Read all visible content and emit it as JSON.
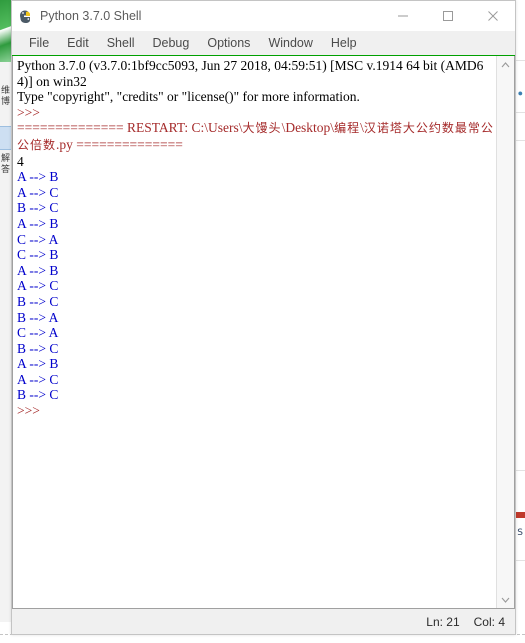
{
  "window": {
    "title": "Python 3.7.0 Shell",
    "icon": "python-idle-icon",
    "controls": {
      "minimize": "minimize-icon",
      "maximize": "maximize-icon",
      "close": "close-icon"
    }
  },
  "menu": {
    "items": [
      {
        "label": "File"
      },
      {
        "label": "Edit"
      },
      {
        "label": "Shell"
      },
      {
        "label": "Debug"
      },
      {
        "label": "Options"
      },
      {
        "label": "Window"
      },
      {
        "label": "Help"
      }
    ]
  },
  "shell": {
    "lines": [
      {
        "text": "Python 3.7.0 (v3.7.0:1bf9cc5093, Jun 27 2018, 04:59:51) [MSC v.1914 64 bit (AMD64)] on win32",
        "color": "black"
      },
      {
        "text": "Type \"copyright\", \"credits\" or \"license()\" for more information.",
        "color": "black"
      },
      {
        "text": ">>> ",
        "color": "prompt"
      },
      {
        "text": "============== RESTART: C:\\Users\\大馒头\\Desktop\\编程\\汉诺塔大公约数最常公公倍数.py ==============",
        "color": "restart"
      },
      {
        "text": "4",
        "color": "black"
      },
      {
        "text": "A --> B",
        "color": "output"
      },
      {
        "text": "A --> C",
        "color": "output"
      },
      {
        "text": "B --> C",
        "color": "output"
      },
      {
        "text": "A --> B",
        "color": "output"
      },
      {
        "text": "C --> A",
        "color": "output"
      },
      {
        "text": "C --> B",
        "color": "output"
      },
      {
        "text": "A --> B",
        "color": "output"
      },
      {
        "text": "A --> C",
        "color": "output"
      },
      {
        "text": "B --> C",
        "color": "output"
      },
      {
        "text": "B --> A",
        "color": "output"
      },
      {
        "text": "C --> A",
        "color": "output"
      },
      {
        "text": "B --> C",
        "color": "output"
      },
      {
        "text": "A --> B",
        "color": "output"
      },
      {
        "text": "A --> C",
        "color": "output"
      },
      {
        "text": "B --> C",
        "color": "output"
      },
      {
        "text": ">>> ",
        "color": "prompt"
      }
    ],
    "scrollbar": {
      "up_arrow": "chevron-up-icon",
      "down_arrow": "chevron-down-icon"
    }
  },
  "status_bar": {
    "line_label": "Ln: 21",
    "column_label": "Col: 4"
  },
  "background": {
    "left_panel_items": [
      {
        "label": "维博"
      },
      {
        "label": "解答"
      }
    ],
    "right_glyph": "S"
  },
  "colors": {
    "accent_green": "#00a000",
    "prompt_brown": "#a52a2a",
    "output_blue": "#0000cc",
    "window_chrome": "#f0f0f0",
    "text_black": "#000000"
  }
}
